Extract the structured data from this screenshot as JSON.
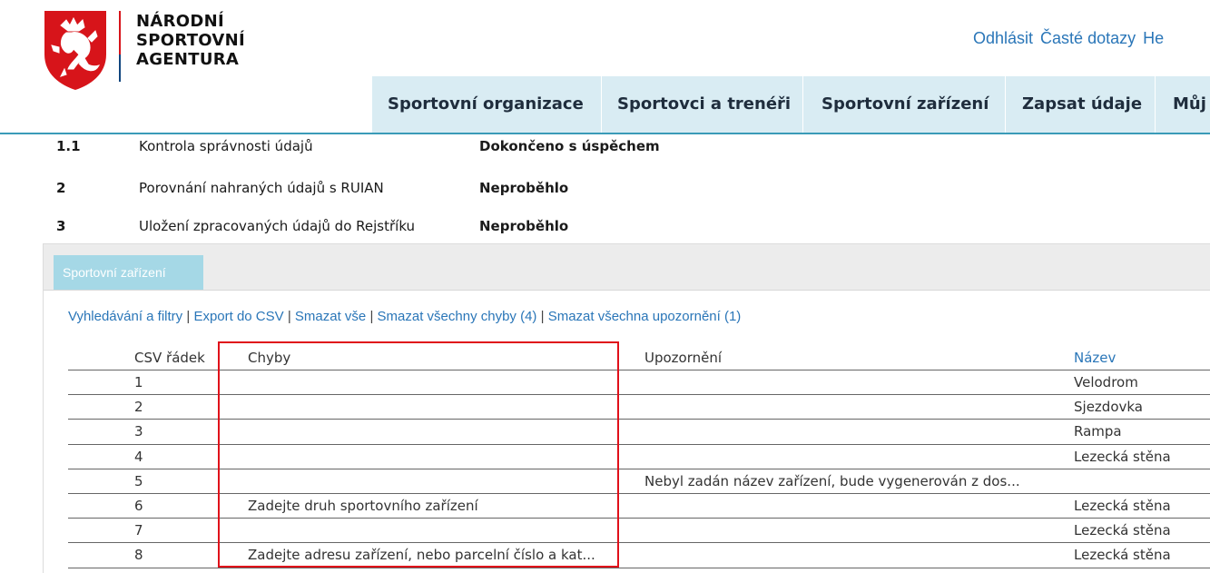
{
  "brand": {
    "line1": "NÁRODNÍ",
    "line2": "SPORTOVNÍ",
    "line3": "AGENTURA"
  },
  "top_links": {
    "logout": "Odhlásit",
    "faq": "Časté dotazy",
    "help": "He"
  },
  "nav": {
    "items": [
      "Sportovní organizace",
      "Sportovci a trenéři",
      "Sportovní zařízení",
      "Zapsat údaje",
      "Můj"
    ]
  },
  "steps": [
    {
      "num": "1.1",
      "name": "Kontrola správnosti údajů",
      "status": "Dokončeno s úspěchem"
    },
    {
      "num": "2",
      "name": "Porovnání nahraných údajů s RUIAN",
      "status": "Neproběhlo"
    },
    {
      "num": "3",
      "name": "Uložení zpracovaných údajů do Rejstříku",
      "status": "Neproběhlo"
    }
  ],
  "tab": {
    "label": "Sportovní zařízení"
  },
  "actions": {
    "search": "Vyhledávání a filtry",
    "export": "Export do CSV",
    "delete_all": "Smazat vše",
    "delete_errors": "Smazat všechny chyby (4)",
    "delete_warnings": "Smazat všechna upozornění (1)",
    "separator": "|"
  },
  "table": {
    "headers": {
      "row": "CSV řádek",
      "errors": "Chyby",
      "warnings": "Upozornění",
      "name": "Název"
    },
    "rows": [
      {
        "row": "1",
        "errors": "",
        "warnings": "",
        "name": "Velodrom"
      },
      {
        "row": "2",
        "errors": "",
        "warnings": "",
        "name": "Sjezdovka"
      },
      {
        "row": "3",
        "errors": "",
        "warnings": "",
        "name": "Rampa"
      },
      {
        "row": "4",
        "errors": "",
        "warnings": "",
        "name": "Lezecká stěna"
      },
      {
        "row": "5",
        "errors": "",
        "warnings": "Nebyl zadán název zařízení, bude vygenerován z dos...",
        "name": ""
      },
      {
        "row": "6",
        "errors": "Zadejte druh sportovního zařízení",
        "warnings": "",
        "name": "Lezecká stěna"
      },
      {
        "row": "7",
        "errors": "",
        "warnings": "",
        "name": "Lezecká stěna"
      },
      {
        "row": "8",
        "errors": "Zadejte adresu zařízení, nebo parcelní číslo a kat...",
        "warnings": "",
        "name": "Lezecká stěna"
      }
    ]
  },
  "colors": {
    "accent_blue": "#2a76b8",
    "nav_bg": "#d9ecf3",
    "tab_bg": "#a5d8e6",
    "highlight_red": "#e0101a"
  }
}
